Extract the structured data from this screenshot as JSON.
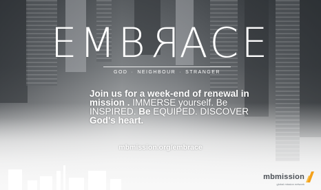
{
  "title": {
    "prefix": "EMB",
    "reversed_letter": "R",
    "suffix": "ACE"
  },
  "tagline": [
    "GOD",
    "NEIGHBOUR",
    "STRANGER"
  ],
  "copy": {
    "part1": "Join us for a week-end of renewal in mission . ",
    "part2": "IMMERSE yourself. Be INSPIRED. ",
    "part3": "Be ",
    "part4": "EQUIPED. DISCOVER ",
    "part5": "God's heart."
  },
  "url": "mbmission.org/embrace",
  "logo": {
    "name": "mbmission",
    "sub": "global mission network"
  },
  "colors": {
    "text": "#ffffff",
    "logo_text": "#4a4f55",
    "logo_mark": "#f4a11b"
  }
}
